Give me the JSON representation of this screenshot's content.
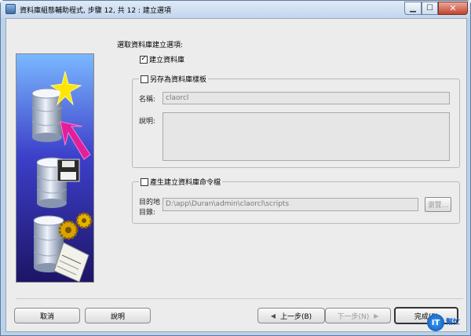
{
  "window": {
    "title": "資料庫組態輔助程式, 步驟 12, 共 12 : 建立選項",
    "min_glyph": "▁",
    "max_glyph": "☐",
    "close_glyph": "✕"
  },
  "main": {
    "heading": "選取資料庫建立選項:",
    "create_db": {
      "label": "建立資料庫",
      "checked": true,
      "mark": "✓"
    },
    "save_template": {
      "label": "另存為資料庫樣板",
      "checked": false,
      "name_label": "名稱:",
      "name_value": "claorcl",
      "desc_label": "說明:",
      "desc_value": ""
    },
    "gen_scripts": {
      "label": "產生建立資料庫命令檔",
      "checked": false,
      "dest_label_1": "目的地",
      "dest_label_2": "目錄:",
      "dest_value": "D:\\app\\Duran\\admin\\claorcl\\scripts",
      "browse_label": "瀏覽..."
    }
  },
  "footer": {
    "cancel_label": "取消",
    "help_label": "說明",
    "back_label": "上一步(B)",
    "back_arrow": "◀",
    "next_label": "下一步(N)",
    "next_arrow": "▶",
    "finish_label": "完成(F)"
  },
  "badge": {
    "mark": "IT",
    "text": "幫忙"
  },
  "colors": {
    "graphic_top": "#6fb0ff",
    "graphic_bottom": "#2a1a7a",
    "arrow_pink": "#e0209a",
    "star_yellow": "#ffe000",
    "gear_gold": "#d9a300"
  }
}
